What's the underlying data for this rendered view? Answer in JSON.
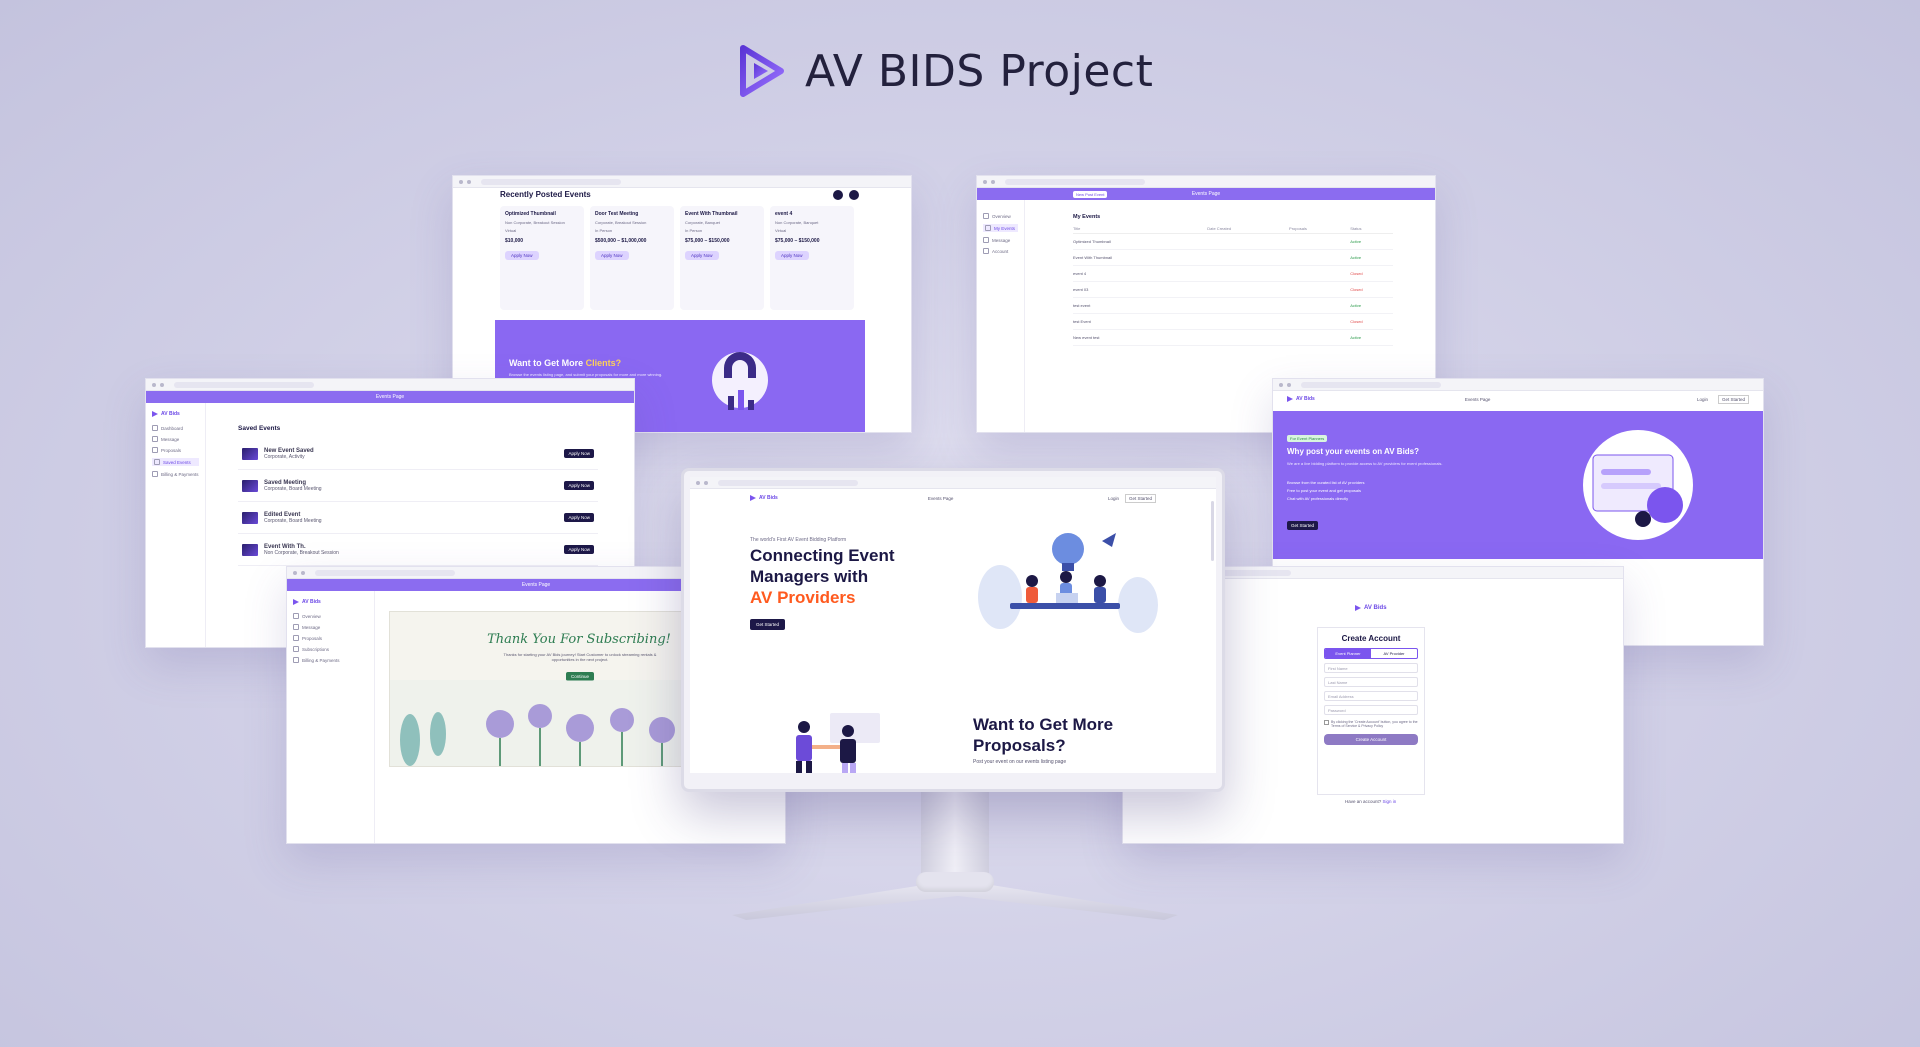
{
  "page": {
    "title": "AV BIDS Project"
  },
  "events_panel": {
    "heading": "Recently Posted Events",
    "cards": [
      {
        "name": "Optimized Thumbnail",
        "type": "Non Corporate, Breakout Session",
        "tag": "Virtual",
        "price": "$10,000"
      },
      {
        "name": "Door Test Meeting",
        "type": "Corporate, Breakout Session",
        "tag": "In Person",
        "price": "$500,000 – $1,000,000"
      },
      {
        "name": "Event With Thumbnail",
        "type": "Corporate, Banquet",
        "tag": "In Person",
        "price": "$75,000 – $150,000"
      },
      {
        "name": "event 4",
        "type": "Non Corporate, Banquet",
        "tag": "Virtual",
        "price": "$75,000 – $150,000"
      }
    ],
    "apply_label": "Apply Now",
    "promo_prefix": "Want to Get More ",
    "promo_accent": "Clients?",
    "promo_body": "Browse the events listing page, and submit your proposals for more and more winning."
  },
  "myevents_panel": {
    "bar_title": "Events Page",
    "button": "New Post Event",
    "heading": "My Events",
    "sidebar": [
      "Overview",
      "My Events",
      "Message",
      "Account"
    ],
    "columns": [
      "Title",
      "Date Created",
      "Proposals",
      "Status"
    ],
    "rows": [
      {
        "title": "Optimized Thumbnail",
        "status": "Active"
      },
      {
        "title": "Event With Thumbnail",
        "status": "Active"
      },
      {
        "title": "event 4",
        "status": "Closed"
      },
      {
        "title": "event 03",
        "status": "Closed"
      },
      {
        "title": "test event",
        "status": "Active"
      },
      {
        "title": "test Event",
        "status": "Closed"
      },
      {
        "title": "New event test",
        "status": "Active"
      }
    ]
  },
  "saved_panel": {
    "bar_title": "Events Page",
    "heading": "Saved Events",
    "sidebar": [
      "Dashboard",
      "Message",
      "Proposals",
      "Saved Events",
      "Billing & Payments"
    ],
    "rows": [
      {
        "name": "New Event Saved",
        "type": "Corporate, Activity",
        "action": "Apply Now"
      },
      {
        "name": "Saved Meeting",
        "type": "Corporate, Board Meeting",
        "action": "Apply Now"
      },
      {
        "name": "Edited Event",
        "type": "Corporate, Board Meeting",
        "action": "Apply Now"
      },
      {
        "name": "Event With Th.",
        "type": "Non Corporate, Breakout Session",
        "action": "Apply Now"
      }
    ]
  },
  "subscribe_panel": {
    "bar_title": "Events Page",
    "sidebar": [
      "Overview",
      "Message",
      "Proposals",
      "Subscriptions",
      "Billing & Payments"
    ],
    "heading": "Thank You For Subscribing!",
    "body": "Thanks for starting your AV Bids journey! Start Customer to unlock streaming rentals & opportunities in the next project.",
    "button": "Continue"
  },
  "why_panel": {
    "nav_title": "Events Page",
    "login": "Login",
    "signup": "Get Started",
    "badge": "For Event Planners",
    "heading": "Why post your events on AV Bids?",
    "body": "We are a live bidding platform to provide access to AV providers for event professionals.",
    "bullets": [
      "Browse from the curated list of AV providers",
      "Free to post your event and get proposals",
      "Chat with AV professionals directly"
    ],
    "cta": "Get Started"
  },
  "account_panel": {
    "logo": "AV Bids",
    "heading": "Create Account",
    "tabs": [
      "Event Planner",
      "AV Provider"
    ],
    "fields": [
      "First Name",
      "Last Name",
      "Email Address",
      "Password"
    ],
    "terms": "By clicking the 'Create Account' button, you agree to the Terms of Service & Privacy Policy",
    "submit": "Create Account",
    "login_prompt": "Have an account? ",
    "login_link": "Sign in"
  },
  "monitor": {
    "nav_title": "Events Page",
    "login": "Login",
    "signup": "Get Started",
    "tagline": "The world's First AV Event Bidding Platform",
    "hero_line1": "Connecting Event",
    "hero_line2": "Managers with",
    "hero_accent": "AV Providers",
    "cta": "Get Started",
    "section_title_1": "Want to Get More",
    "section_title_2": "Proposals?",
    "section_body": "Post your event on our events listing page"
  },
  "colors": {
    "brand": "#7B55EE",
    "accent": "#FF5A1F",
    "navy": "#1C1845"
  },
  "icons": [
    "logo-play-icon",
    "hero-illustration",
    "rocket-icon",
    "lightbulb-icon",
    "handshake-illustration",
    "floral-illustration"
  ]
}
